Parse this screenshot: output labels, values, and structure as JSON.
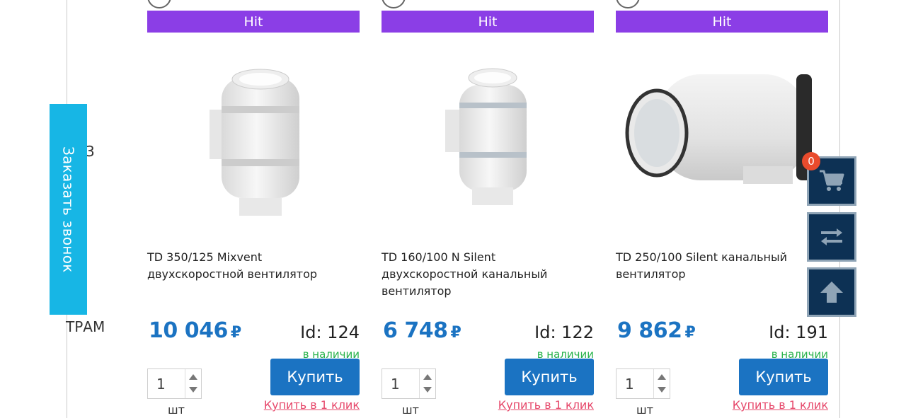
{
  "sidebar": {
    "fragment_top": "3",
    "fragment_bottom": "ТРАМ"
  },
  "callback": {
    "label": "Заказать звонок"
  },
  "products": [
    {
      "badge": "Hit",
      "title": "TD 350/125 Mixvent двухскоростной вентилятор",
      "price": "10 046",
      "currency": "₽",
      "id_text": "Id: 124",
      "stock": "в наличии",
      "qty": "1",
      "unit": "шт",
      "buy_label": "Купить",
      "one_click_label": "Купить в 1 клик"
    },
    {
      "badge": "Hit",
      "title": "TD 160/100 N Silent двухскоростной канальный вентилятор",
      "price": "6 748",
      "currency": "₽",
      "id_text": "Id: 122",
      "stock": "в наличии",
      "qty": "1",
      "unit": "шт",
      "buy_label": "Купить",
      "one_click_label": "Купить в 1 клик"
    },
    {
      "badge": "Hit",
      "title": "TD 250/100 Silent канальный вентилятор",
      "price": "9 862",
      "currency": "₽",
      "id_text": "Id: 191",
      "stock": "в наличии",
      "qty": "1",
      "unit": "шт",
      "buy_label": "Купить",
      "one_click_label": "Купить в 1 клик"
    }
  ],
  "floating": {
    "cart_count": "0",
    "cart_icon": "cart-icon",
    "compare_icon": "compare-arrows-icon",
    "scroll_top_icon": "arrow-up-icon"
  },
  "colors": {
    "accent_blue": "#1b73c2",
    "hit_purple": "#8b3ee6",
    "callback_cyan": "#17b6e5",
    "stock_green": "#27b24a",
    "link_pink": "#e6476a",
    "float_navy": "#0d3154",
    "badge_red": "#e94b2c"
  }
}
